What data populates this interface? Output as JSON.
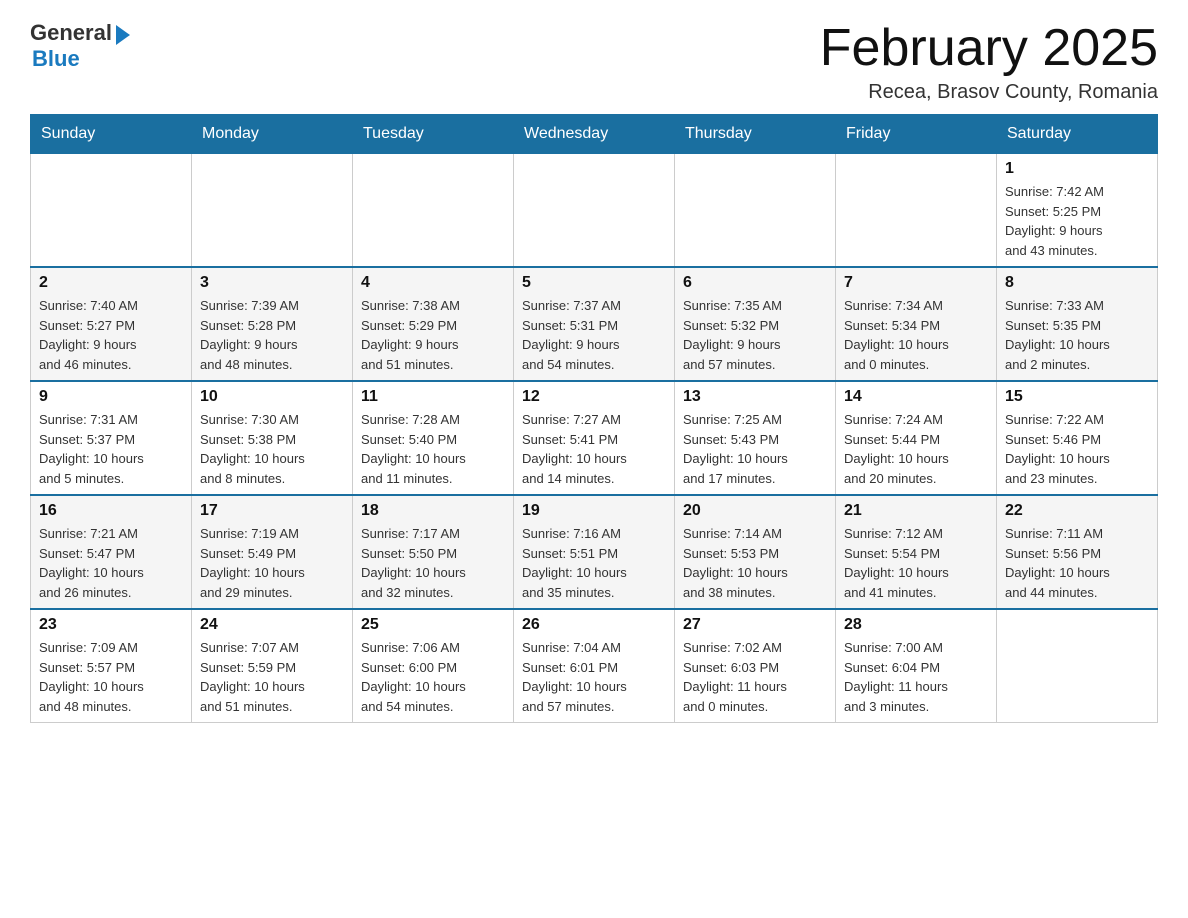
{
  "logo": {
    "general": "General",
    "blue": "Blue"
  },
  "title": "February 2025",
  "subtitle": "Recea, Brasov County, Romania",
  "weekdays": [
    "Sunday",
    "Monday",
    "Tuesday",
    "Wednesday",
    "Thursday",
    "Friday",
    "Saturday"
  ],
  "weeks": [
    [
      {
        "day": "",
        "info": ""
      },
      {
        "day": "",
        "info": ""
      },
      {
        "day": "",
        "info": ""
      },
      {
        "day": "",
        "info": ""
      },
      {
        "day": "",
        "info": ""
      },
      {
        "day": "",
        "info": ""
      },
      {
        "day": "1",
        "info": "Sunrise: 7:42 AM\nSunset: 5:25 PM\nDaylight: 9 hours\nand 43 minutes."
      }
    ],
    [
      {
        "day": "2",
        "info": "Sunrise: 7:40 AM\nSunset: 5:27 PM\nDaylight: 9 hours\nand 46 minutes."
      },
      {
        "day": "3",
        "info": "Sunrise: 7:39 AM\nSunset: 5:28 PM\nDaylight: 9 hours\nand 48 minutes."
      },
      {
        "day": "4",
        "info": "Sunrise: 7:38 AM\nSunset: 5:29 PM\nDaylight: 9 hours\nand 51 minutes."
      },
      {
        "day": "5",
        "info": "Sunrise: 7:37 AM\nSunset: 5:31 PM\nDaylight: 9 hours\nand 54 minutes."
      },
      {
        "day": "6",
        "info": "Sunrise: 7:35 AM\nSunset: 5:32 PM\nDaylight: 9 hours\nand 57 minutes."
      },
      {
        "day": "7",
        "info": "Sunrise: 7:34 AM\nSunset: 5:34 PM\nDaylight: 10 hours\nand 0 minutes."
      },
      {
        "day": "8",
        "info": "Sunrise: 7:33 AM\nSunset: 5:35 PM\nDaylight: 10 hours\nand 2 minutes."
      }
    ],
    [
      {
        "day": "9",
        "info": "Sunrise: 7:31 AM\nSunset: 5:37 PM\nDaylight: 10 hours\nand 5 minutes."
      },
      {
        "day": "10",
        "info": "Sunrise: 7:30 AM\nSunset: 5:38 PM\nDaylight: 10 hours\nand 8 minutes."
      },
      {
        "day": "11",
        "info": "Sunrise: 7:28 AM\nSunset: 5:40 PM\nDaylight: 10 hours\nand 11 minutes."
      },
      {
        "day": "12",
        "info": "Sunrise: 7:27 AM\nSunset: 5:41 PM\nDaylight: 10 hours\nand 14 minutes."
      },
      {
        "day": "13",
        "info": "Sunrise: 7:25 AM\nSunset: 5:43 PM\nDaylight: 10 hours\nand 17 minutes."
      },
      {
        "day": "14",
        "info": "Sunrise: 7:24 AM\nSunset: 5:44 PM\nDaylight: 10 hours\nand 20 minutes."
      },
      {
        "day": "15",
        "info": "Sunrise: 7:22 AM\nSunset: 5:46 PM\nDaylight: 10 hours\nand 23 minutes."
      }
    ],
    [
      {
        "day": "16",
        "info": "Sunrise: 7:21 AM\nSunset: 5:47 PM\nDaylight: 10 hours\nand 26 minutes."
      },
      {
        "day": "17",
        "info": "Sunrise: 7:19 AM\nSunset: 5:49 PM\nDaylight: 10 hours\nand 29 minutes."
      },
      {
        "day": "18",
        "info": "Sunrise: 7:17 AM\nSunset: 5:50 PM\nDaylight: 10 hours\nand 32 minutes."
      },
      {
        "day": "19",
        "info": "Sunrise: 7:16 AM\nSunset: 5:51 PM\nDaylight: 10 hours\nand 35 minutes."
      },
      {
        "day": "20",
        "info": "Sunrise: 7:14 AM\nSunset: 5:53 PM\nDaylight: 10 hours\nand 38 minutes."
      },
      {
        "day": "21",
        "info": "Sunrise: 7:12 AM\nSunset: 5:54 PM\nDaylight: 10 hours\nand 41 minutes."
      },
      {
        "day": "22",
        "info": "Sunrise: 7:11 AM\nSunset: 5:56 PM\nDaylight: 10 hours\nand 44 minutes."
      }
    ],
    [
      {
        "day": "23",
        "info": "Sunrise: 7:09 AM\nSunset: 5:57 PM\nDaylight: 10 hours\nand 48 minutes."
      },
      {
        "day": "24",
        "info": "Sunrise: 7:07 AM\nSunset: 5:59 PM\nDaylight: 10 hours\nand 51 minutes."
      },
      {
        "day": "25",
        "info": "Sunrise: 7:06 AM\nSunset: 6:00 PM\nDaylight: 10 hours\nand 54 minutes."
      },
      {
        "day": "26",
        "info": "Sunrise: 7:04 AM\nSunset: 6:01 PM\nDaylight: 10 hours\nand 57 minutes."
      },
      {
        "day": "27",
        "info": "Sunrise: 7:02 AM\nSunset: 6:03 PM\nDaylight: 11 hours\nand 0 minutes."
      },
      {
        "day": "28",
        "info": "Sunrise: 7:00 AM\nSunset: 6:04 PM\nDaylight: 11 hours\nand 3 minutes."
      },
      {
        "day": "",
        "info": ""
      }
    ]
  ]
}
